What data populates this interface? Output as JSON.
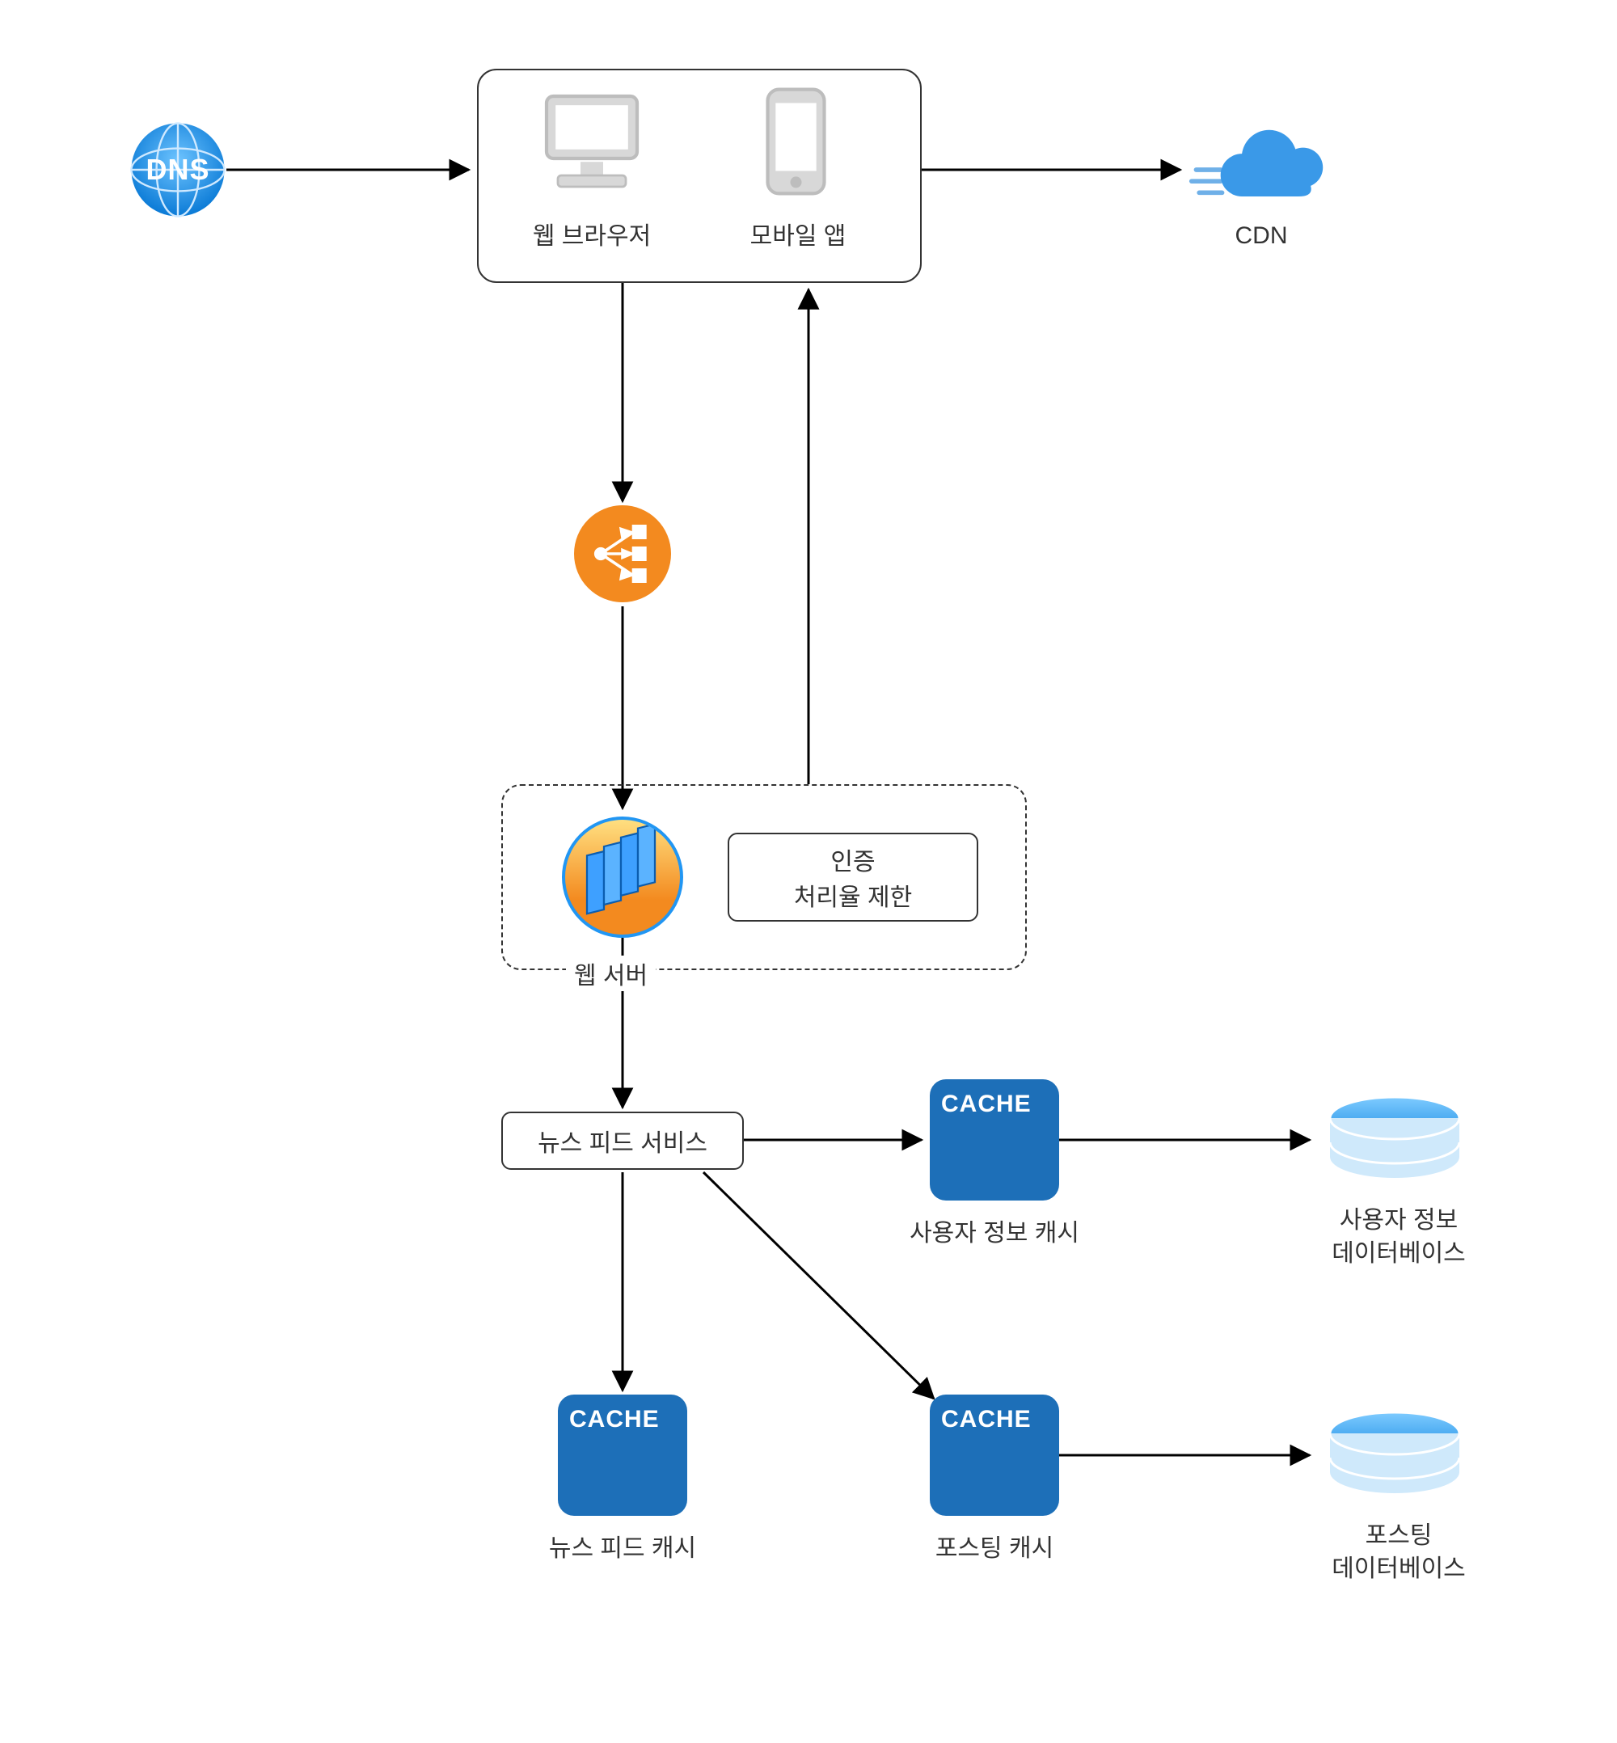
{
  "nodes": {
    "dns": {
      "label": "DNS"
    },
    "clients": {
      "web_browser": "웹 브라우저",
      "mobile_app": "모바일 앱"
    },
    "cdn": {
      "label": "CDN"
    },
    "load_balancer": {
      "label": ""
    },
    "web_server_group": {
      "title": "웹 서버",
      "functions_line1": "인증",
      "functions_line2": "처리율 제한"
    },
    "newsfeed_service": {
      "label": "뉴스 피드 서비스"
    },
    "caches": {
      "user_info": {
        "badge": "CACHE",
        "label": "사용자 정보 캐시"
      },
      "newsfeed": {
        "badge": "CACHE",
        "label": "뉴스 피드 캐시"
      },
      "posting": {
        "badge": "CACHE",
        "label": "포스팅 캐시"
      }
    },
    "databases": {
      "user_info": {
        "line1": "사용자 정보",
        "line2": "데이터베이스"
      },
      "posting": {
        "line1": "포스팅",
        "line2": "데이터베이스"
      }
    }
  },
  "edges": [
    {
      "from": "dns",
      "to": "clients"
    },
    {
      "from": "clients",
      "to": "cdn"
    },
    {
      "from": "clients",
      "to": "load_balancer"
    },
    {
      "from": "load_balancer",
      "to": "web_server"
    },
    {
      "from": "web_server_group",
      "to": "clients"
    },
    {
      "from": "web_server",
      "to": "newsfeed_service"
    },
    {
      "from": "newsfeed_service",
      "to": "cache.user_info"
    },
    {
      "from": "newsfeed_service",
      "to": "cache.newsfeed"
    },
    {
      "from": "newsfeed_service",
      "to": "cache.posting"
    },
    {
      "from": "cache.user_info",
      "to": "db.user_info"
    },
    {
      "from": "cache.posting",
      "to": "db.posting"
    }
  ]
}
